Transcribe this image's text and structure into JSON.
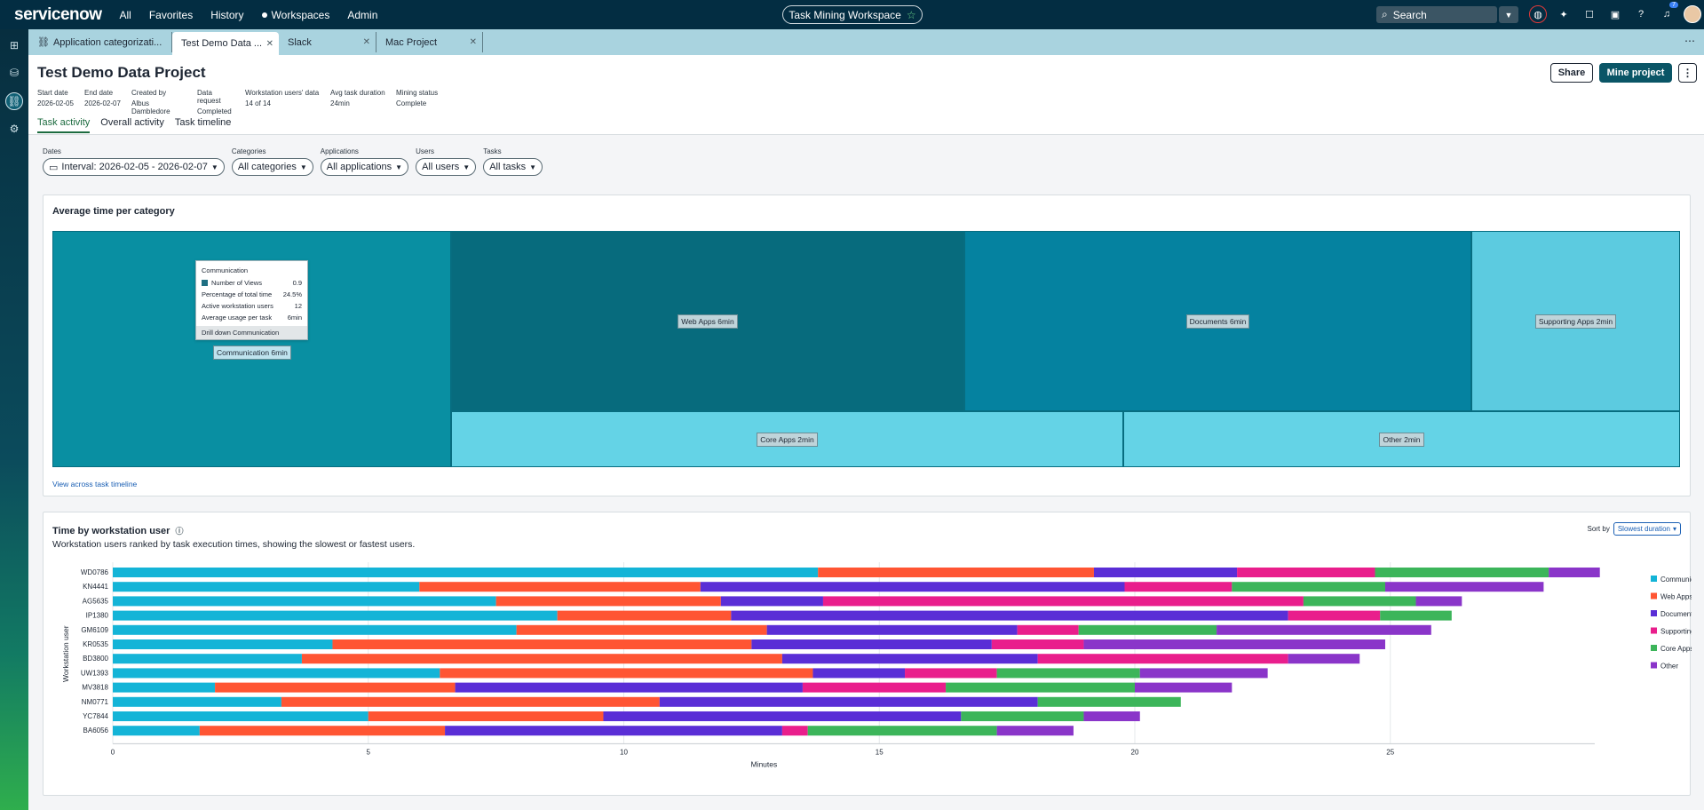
{
  "topbar": {
    "logo": "servicenow",
    "nav": [
      "All",
      "Favorites",
      "History",
      "Workspaces",
      "Admin"
    ],
    "workspace": "Task Mining Workspace",
    "search_placeholder": "Search",
    "notif_count": "7"
  },
  "tabs": [
    {
      "label": "Application categorizati..."
    },
    {
      "label": "Test Demo Data ..."
    },
    {
      "label": "Slack"
    },
    {
      "label": "Mac Project"
    }
  ],
  "header": {
    "title": "Test Demo Data Project",
    "meta": [
      {
        "k": "Start date",
        "v": "2026-02-05"
      },
      {
        "k": "End date",
        "v": "2026-02-07"
      },
      {
        "k": "Created by",
        "v": "Albus Dambledore"
      },
      {
        "k": "Data request",
        "v": "Completed"
      },
      {
        "k": "Workstation users' data",
        "v": "14 of 14"
      },
      {
        "k": "Avg task duration",
        "v": "24min"
      },
      {
        "k": "Mining status",
        "v": "Complete"
      }
    ],
    "share": "Share",
    "mine": "Mine project",
    "subtabs": [
      "Task activity",
      "Overall activity",
      "Task timeline"
    ]
  },
  "filters": [
    {
      "label": "Dates",
      "value": "Interval: 2026-02-05 - 2026-02-07"
    },
    {
      "label": "Categories",
      "value": "All categories"
    },
    {
      "label": "Applications",
      "value": "All applications"
    },
    {
      "label": "Users",
      "value": "All users"
    },
    {
      "label": "Tasks",
      "value": "All tasks"
    }
  ],
  "treemap": {
    "title": "Average time per category",
    "cells": [
      {
        "label": "Communication 6min",
        "color": "#098fa2"
      },
      {
        "label": "Web Apps 6min",
        "color": "#076b7d"
      },
      {
        "label": "Documents 6min",
        "color": "#0582a0"
      },
      {
        "label": "Supporting Apps 2min",
        "color": "#5ccbe0"
      },
      {
        "label": "Core Apps 2min",
        "color": "#64d3e6"
      },
      {
        "label": "Other 2min",
        "color": "#64d3e6"
      }
    ],
    "tooltip": {
      "title": "Communication",
      "rows": [
        {
          "k": "Number of Views",
          "v": "0.9"
        },
        {
          "k": "Percentage of total time",
          "v": "24.5%"
        },
        {
          "k": "Active workstation users",
          "v": "12"
        },
        {
          "k": "Average usage per task",
          "v": "6min"
        }
      ],
      "drill": "Drill down Communication"
    },
    "link": "View across task timeline"
  },
  "bar_card": {
    "title": "Time by workstation user",
    "subtitle": "Workstation users ranked by task execution times, showing the slowest or fastest users.",
    "sort_label": "Sort by",
    "sort_value": "Slowest duration"
  },
  "chart_data": {
    "type": "bar",
    "orientation": "horizontal",
    "stacked": true,
    "xlabel": "Minutes",
    "ylabel": "Workstation user",
    "xlim": [
      0,
      29
    ],
    "xticks": [
      0,
      5,
      10,
      15,
      20,
      25
    ],
    "categories": [
      "WD0786",
      "KN4441",
      "AG5635",
      "IP1380",
      "GM6109",
      "KR0535",
      "BD3800",
      "UW1393",
      "MV3818",
      "NM0771",
      "YC7844",
      "BA6056"
    ],
    "series": [
      {
        "name": "Communication",
        "color": "#14b4d7",
        "values": [
          13.8,
          6.0,
          7.5,
          8.7,
          7.9,
          4.3,
          3.7,
          6.4,
          2.0,
          3.3,
          5.0,
          1.7
        ]
      },
      {
        "name": "Web Apps",
        "color": "#ff5533",
        "values": [
          5.4,
          5.5,
          4.4,
          3.4,
          4.9,
          8.2,
          9.4,
          7.3,
          4.7,
          7.4,
          4.6,
          4.8
        ]
      },
      {
        "name": "Documents",
        "color": "#5a2ed6",
        "values": [
          2.8,
          8.3,
          2.0,
          10.9,
          4.9,
          4.7,
          5.0,
          1.8,
          6.8,
          7.4,
          7.0,
          6.6
        ]
      },
      {
        "name": "Supporting Apps",
        "color": "#e91e8c",
        "values": [
          2.7,
          2.1,
          9.4,
          1.8,
          1.2,
          1.8,
          4.9,
          1.8,
          2.8,
          0.0,
          0.0,
          0.5
        ]
      },
      {
        "name": "Core Apps",
        "color": "#3cb55a",
        "values": [
          3.4,
          3.0,
          2.2,
          1.4,
          2.7,
          0.0,
          0.0,
          2.8,
          3.7,
          2.8,
          2.4,
          3.7
        ]
      },
      {
        "name": "Other",
        "color": "#8a35c9",
        "values": [
          1.0,
          3.1,
          0.9,
          0.0,
          4.2,
          5.9,
          1.4,
          2.5,
          1.9,
          0.0,
          1.1,
          1.5
        ]
      }
    ]
  }
}
